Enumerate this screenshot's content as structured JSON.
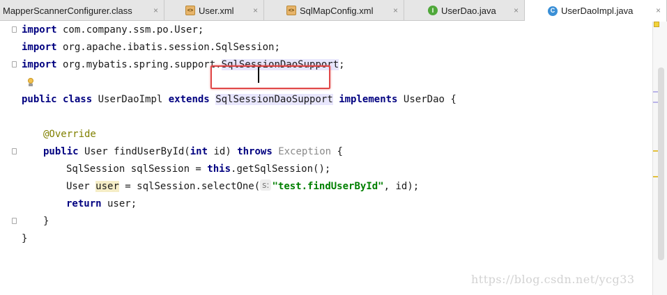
{
  "tabs": [
    {
      "label": "MapperScannerConfigurer.class",
      "icon": "class-file-icon",
      "active": false
    },
    {
      "label": "User.xml",
      "icon": "xml-file-icon",
      "active": false
    },
    {
      "label": "SqlMapConfig.xml",
      "icon": "xml-file-icon",
      "active": false
    },
    {
      "label": "UserDao.java",
      "icon": "interface-icon",
      "active": false
    },
    {
      "label": "UserDaoImpl.java",
      "icon": "class-icon",
      "active": true
    }
  ],
  "tab_icon_glyphs": {
    "xml": "<>",
    "interface": "I",
    "class": "C"
  },
  "tab_close": "×",
  "code": {
    "l1": {
      "kw": "import",
      "rest": " com.company.ssm.po.User;"
    },
    "l2": {
      "kw": "import",
      "rest": " org.apache.ibatis.session.SqlSession;"
    },
    "l3": {
      "kw": "import",
      "pre": " org.mybatis.spring.support.",
      "hl": "SqlSessionDaoSupport",
      "post": ";"
    },
    "l4": {
      "kw1": "public class",
      "name": " UserDaoImpl ",
      "kw2": "extends",
      "sp": " ",
      "hl": "SqlSessionDaoSupport",
      "sp2": " ",
      "kw3": "implements",
      "rest": " UserDao {"
    },
    "l5": {
      "ann": "@Override"
    },
    "l6": {
      "kw1": "public",
      "mid": " User findUserById(",
      "kw2": "int",
      "mid2": " id) ",
      "kw3": "throws",
      "sp": " ",
      "exc": "Exception",
      "rest": " {"
    },
    "l7": {
      "pre": "SqlSession sqlSession = ",
      "kw": "this",
      "rest": ".getSqlSession();"
    },
    "l8": {
      "pre": "User ",
      "usage": "user",
      "mid": " = sqlSession.selectOne(",
      "hint": "s:",
      "str": "\"test.findUserById\"",
      "rest": ", id);"
    },
    "l9": {
      "kw": "return",
      "rest": " user;"
    },
    "l10": {
      "text": "}"
    },
    "l11": {
      "text": "}"
    }
  },
  "watermark": "https://blog.csdn.net/ycg33",
  "colors": {
    "keyword": "#000080",
    "annotation": "#808000",
    "string": "#008000",
    "highlight_box": "#e04848"
  }
}
